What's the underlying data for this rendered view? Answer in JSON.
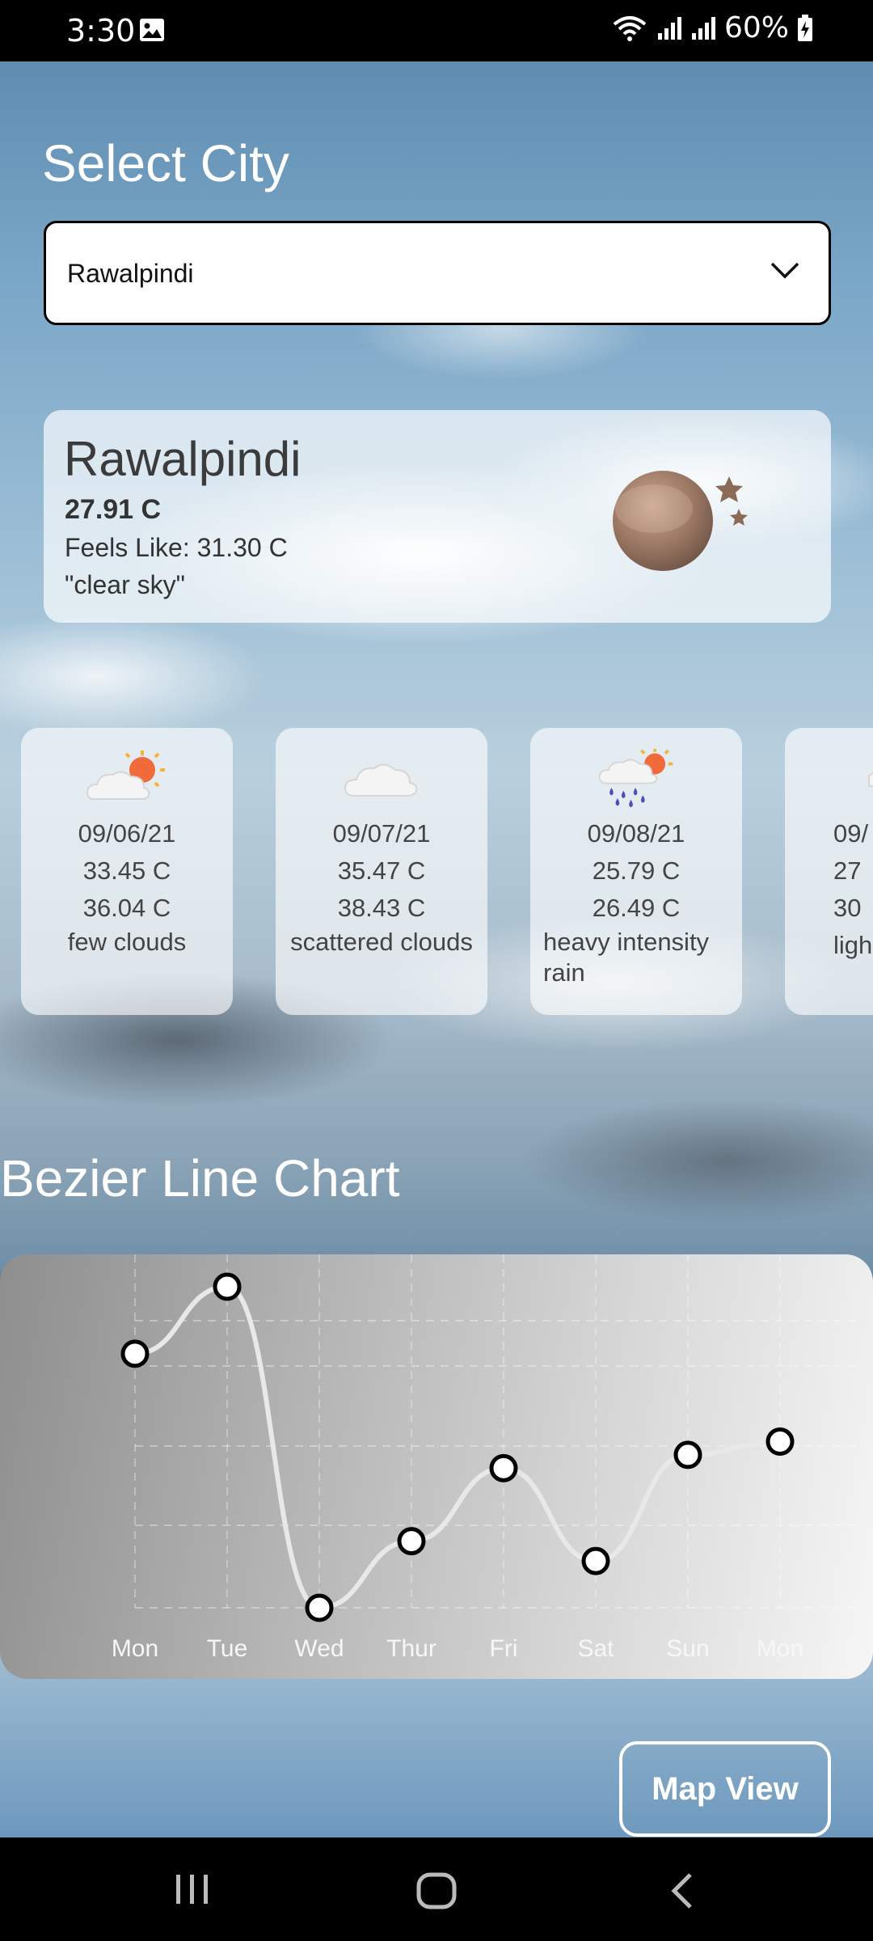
{
  "status_bar": {
    "time": "3:30",
    "battery": "60%"
  },
  "header": {
    "title": "Select City"
  },
  "city_select": {
    "value": "Rawalpindi"
  },
  "current": {
    "city": "Rawalpindi",
    "temp": "27.91 C",
    "feels_like": "Feels Like: 31.30 C",
    "description": "\"clear sky\"",
    "icon": "moon-clear-night-icon"
  },
  "forecast": [
    {
      "date": "09/06/21",
      "max": "33.45 C",
      "feels": "36.04 C",
      "desc": "few clouds",
      "icon": "cloud-sun-icon"
    },
    {
      "date": "09/07/21",
      "max": "35.47 C",
      "feels": "38.43 C",
      "desc": "scattered clouds",
      "icon": "cloud-icon"
    },
    {
      "date": "09/08/21",
      "max": "25.79 C",
      "feels": "26.49 C",
      "desc": "heavy intensity rain",
      "icon": "rain-sun-icon"
    },
    {
      "date": "09/",
      "max": "27",
      "feels": "30",
      "desc": "ligh",
      "icon": "rain-icon"
    }
  ],
  "chart": {
    "title": "Bezier Line Chart"
  },
  "chart_data": {
    "type": "line",
    "title": "Bezier Line Chart",
    "categories": [
      "Mon",
      "Tue",
      "Wed",
      "Thur",
      "Fri",
      "Sat",
      "Sun",
      "Mon"
    ],
    "series": [
      {
        "values": [
          33.45,
          35.47,
          25.79,
          27.8,
          30.0,
          27.2,
          30.4,
          30.8
        ]
      }
    ],
    "ylim": [
      25.79,
      35.47
    ],
    "grid": true,
    "curve": "bezier",
    "line_color": "#e8e8e8",
    "dot_fill": "#ffffff",
    "dot_stroke": "#000000"
  },
  "map_button": {
    "label": "Map View"
  }
}
